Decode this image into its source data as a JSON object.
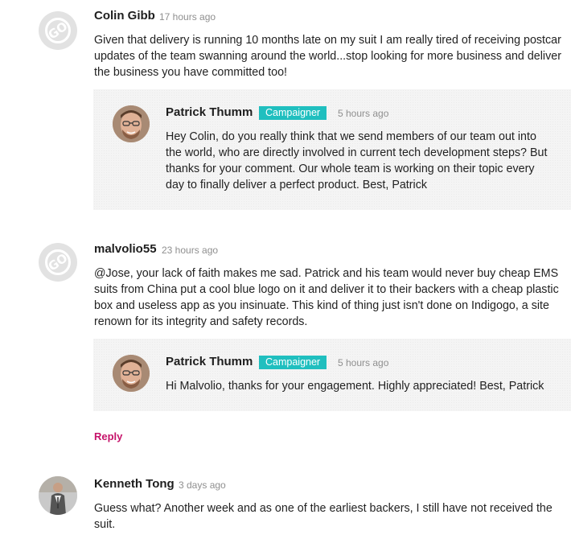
{
  "comments": [
    {
      "author": "Colin Gibb",
      "time": "17 hours ago",
      "avatar_icon": "go-avatar-icon",
      "avatar_text": "GO",
      "text_lines": [
        "Given that delivery is running 10 months late on my suit I am really tired of receiving postcar",
        "updates of the team swanning around the world...stop looking for more business and deliver",
        "the business you have committed too!"
      ],
      "reply": {
        "author": "Patrick Thumm",
        "badge": "Campaigner",
        "time": "5 hours ago",
        "text_lines": [
          "Hey Colin, do you really think that we send members of our team out into",
          "the world, who are directly involved in current tech development steps? But",
          "thanks for your comment. Our whole team is working on their topic every",
          "day to finally deliver a perfect product. Best, Patrick"
        ]
      }
    },
    {
      "author": "malvolio55",
      "time": "23 hours ago",
      "avatar_icon": "go-avatar-icon",
      "avatar_text": "GO",
      "text_lines": [
        "@Jose, your lack of faith makes me sad. Patrick and his team would never buy cheap EMS",
        "suits from China put a cool blue logo on it and deliver it to their backers with a cheap plastic",
        "box and useless app as you insinuate. This kind of thing just isn't done on Indigogo, a site",
        "renown for its integrity and safety records."
      ],
      "reply": {
        "author": "Patrick Thumm",
        "badge": "Campaigner",
        "time": "5 hours ago",
        "text_lines": [
          "Hi Malvolio, thanks for your engagement. Highly appreciated! Best, Patrick"
        ]
      },
      "reply_link": "Reply"
    },
    {
      "author": "Kenneth Tong",
      "time": "3 days ago",
      "avatar_icon": "user-photo-avatar",
      "text_lines": [
        "Guess what? Another week and as one of the earliest backers, I still have not received the",
        "suit."
      ]
    }
  ],
  "colors": {
    "badge": "#20bfbf",
    "reply_link": "#c6136a",
    "reply_box_bg": "#f4f4f4",
    "muted": "#8f8f8f"
  }
}
